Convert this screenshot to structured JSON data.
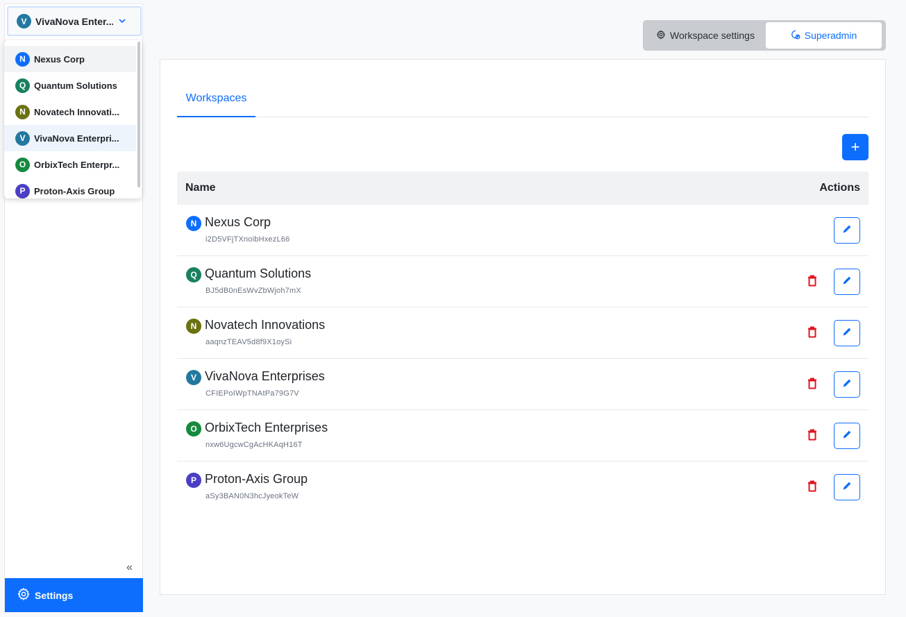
{
  "sidebar": {
    "current_workspace": {
      "initial": "V",
      "name": "VivaNova Enter...",
      "color": "#23789f"
    },
    "dropdown_items": [
      {
        "initial": "N",
        "label": "Nexus Corp",
        "color": "#0d6efd",
        "state": "hover"
      },
      {
        "initial": "Q",
        "label": "Quantum Solutions",
        "color": "#198060",
        "state": ""
      },
      {
        "initial": "N",
        "label": "Novatech Innovati...",
        "color": "#6b7210",
        "state": ""
      },
      {
        "initial": "V",
        "label": "VivaNova Enterpri...",
        "color": "#23789f",
        "state": "selected"
      },
      {
        "initial": "O",
        "label": "OrbixTech Enterpr...",
        "color": "#158a3e",
        "state": ""
      },
      {
        "initial": "P",
        "label": "Proton-Axis Group",
        "color": "#4a3fc4",
        "state": ""
      }
    ],
    "collapse_glyph": "«",
    "settings_label": "Settings"
  },
  "header": {
    "workspace_settings_label": "Workspace settings",
    "superadmin_label": "Superadmin"
  },
  "main": {
    "tabs": [
      {
        "label": "Workspaces",
        "active": true
      }
    ],
    "add_label": "+",
    "table": {
      "columns": [
        "Name",
        "Actions"
      ],
      "rows": [
        {
          "initial": "N",
          "name": "Nexus Corp",
          "id": "i2D5VFjTXnoibHxezL66",
          "color": "#0d6efd",
          "deletable": false
        },
        {
          "initial": "Q",
          "name": "Quantum Solutions",
          "id": "BJ5dB0nEsWvZbWjoh7mX",
          "color": "#198060",
          "deletable": true
        },
        {
          "initial": "N",
          "name": "Novatech Innovations",
          "id": "aaqnzTEAV5d8f9X1oySi",
          "color": "#6b7210",
          "deletable": true
        },
        {
          "initial": "V",
          "name": "VivaNova Enterprises",
          "id": "CFIEPoIWpTNAtPa79G7V",
          "color": "#23789f",
          "deletable": true
        },
        {
          "initial": "O",
          "name": "OrbixTech Enterprises",
          "id": "nxw6UgcwCgAcHKAqH16T",
          "color": "#158a3e",
          "deletable": true
        },
        {
          "initial": "P",
          "name": "Proton-Axis Group",
          "id": "aSy3BAN0N3hcJyeokTeW",
          "color": "#4a3fc4",
          "deletable": true
        }
      ]
    }
  },
  "colors": {
    "accent": "#0d6efd",
    "danger": "#e0151f"
  }
}
